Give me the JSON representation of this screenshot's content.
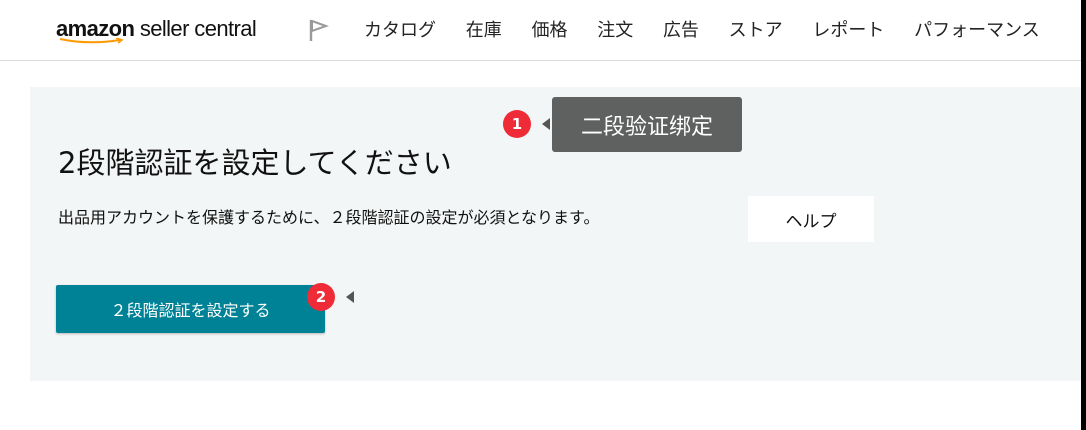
{
  "header": {
    "logo_brand": "amazon",
    "logo_rest": " seller central",
    "nav_items": [
      "カタログ",
      "在庫",
      "価格",
      "注文",
      "広告",
      "ストア",
      "レポート",
      "パフォーマンス"
    ]
  },
  "main": {
    "title": "2段階認証を設定してください",
    "description": "出品用アカウントを保護するために、２段階認証の設定が必須となります。",
    "help_label": "ヘルプ",
    "setup_button_label": "２段階認証を設定する"
  },
  "annotations": {
    "badge_1": "1",
    "badge_2": "2",
    "tooltip_1": "二段验证绑定"
  },
  "colors": {
    "primary_button": "#008296",
    "badge": "#ee2b36",
    "tooltip_bg": "#5f6160",
    "panel_bg": "#f3f6f6"
  },
  "icons": {
    "flag": "flag-icon",
    "arrow": "arrow-left-icon"
  }
}
